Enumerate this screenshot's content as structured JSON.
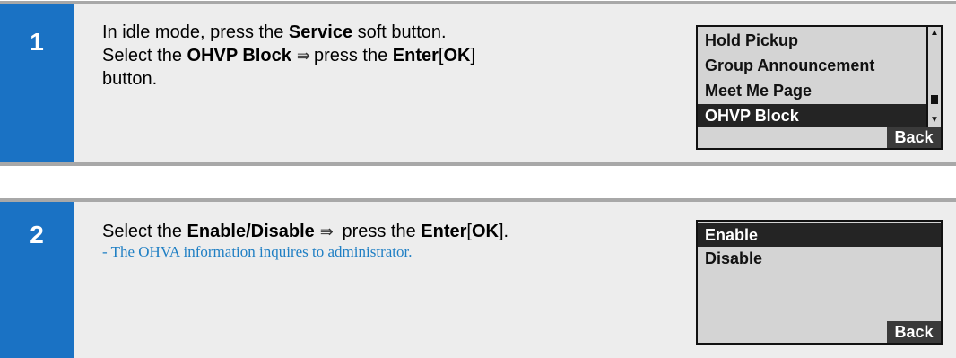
{
  "steps": [
    {
      "number": "1",
      "line1": {
        "t1": "In idle mode, press the ",
        "b1": "Service",
        "t2": " soft button."
      },
      "line2": {
        "t1": "Select the ",
        "b1": "OHVP Block",
        "arrow": "⇛",
        "t2": "press the ",
        "b2": "Enter",
        "t3": "[",
        "b3": "OK",
        "t4": "]"
      },
      "line3": "button.",
      "lcd": {
        "items": [
          "Hold Pickup",
          "Group Announcement",
          "Meet Me Page",
          "OHVP Block"
        ],
        "selected_index": 3,
        "back_label": "Back",
        "scroll_up": "▲",
        "scroll_down": "▼"
      }
    },
    {
      "number": "2",
      "line1": {
        "t1": "Select the ",
        "b1": "Enable/Disable",
        "arrow": "⇛",
        "t2": " press the ",
        "b2": "Enter",
        "t3": "[",
        "b3": "OK",
        "t4": "]."
      },
      "note": "- The OHVA  information inquires to administrator.",
      "lcd": {
        "items": [
          "Enable",
          "Disable"
        ],
        "selected_index": 0,
        "back_label": "Back"
      }
    }
  ],
  "colors": {
    "step_blue": "#1a72c4",
    "note_blue": "#1f7fc4",
    "panel_gray": "#ededed",
    "lcd_gray": "#d4d4d4"
  }
}
